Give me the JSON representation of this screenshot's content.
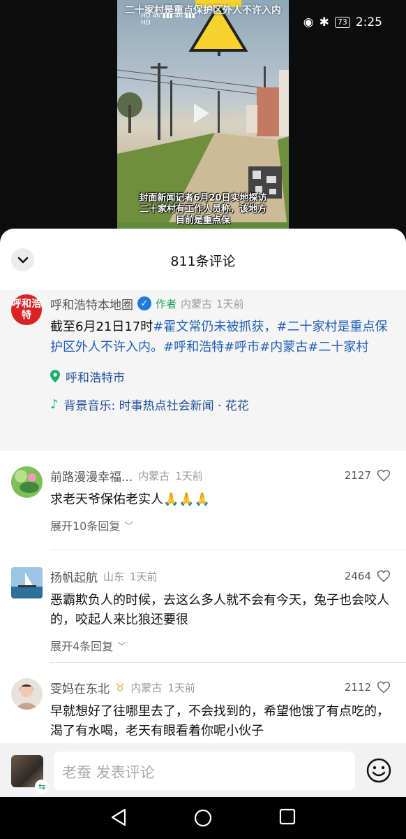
{
  "status_bar": {
    "time": "2:25",
    "battery": "73",
    "network_labels": [
      "HD",
      "46",
      "46",
      "HD"
    ]
  },
  "video": {
    "caption_top": "二十家村是重点保护区外人不许入内",
    "caption_bottom": [
      "封面新闻记者6月20日实地探访",
      "二十家村有工作人员称，该地方",
      "目前是重点保"
    ]
  },
  "sheet": {
    "title": "811条评论"
  },
  "author_post": {
    "avatar_text": "呼和浩特",
    "name": "呼和浩特本地圈",
    "tag": "作者",
    "region": "内蒙古",
    "time": "1天前",
    "text_plain_1": "截至6月21日17时",
    "hashtag_1": "#霍文常仍未被抓获，",
    "hashtag_2": "#二十家村是重点保护区外人不许入内。",
    "hashtag_3": "#呼和浩特",
    "hashtag_4": "#呼市",
    "hashtag_5": "#内蒙古",
    "hashtag_6": "#二十家村",
    "location": "呼和浩特市",
    "music": "背景音乐: 时事热点社会新闻 · 花花"
  },
  "comments": [
    {
      "name": "前路漫漫幸福...",
      "region": "内蒙古",
      "time": "1天前",
      "likes": "2127",
      "text": "求老天爷保佑老实人🙏🙏🙏",
      "expand": "展开10条回复"
    },
    {
      "name": "扬帆起航",
      "region": "山东",
      "time": "1天前",
      "likes": "2464",
      "text": "恶霸欺负人的时候，去这么多人就不会有今天，兔子也会咬人的，咬起人来比狼还要很",
      "expand": "展开4条回复"
    },
    {
      "name": "雯妈在东北",
      "region": "内蒙古",
      "time": "1天前",
      "likes": "2112",
      "text": "早就想好了往哪里去了，不会找到的，希望他饿了有点吃的，渴了有水喝，老天有眼看着你呢小伙子"
    }
  ],
  "input_bar": {
    "placeholder": "老蚕 发表评论"
  },
  "colors": {
    "hashtag": "#1f5fb8",
    "author_tag": "#1aa05a",
    "verified": "#1f7ae0",
    "location_icon": "#15b06c"
  }
}
